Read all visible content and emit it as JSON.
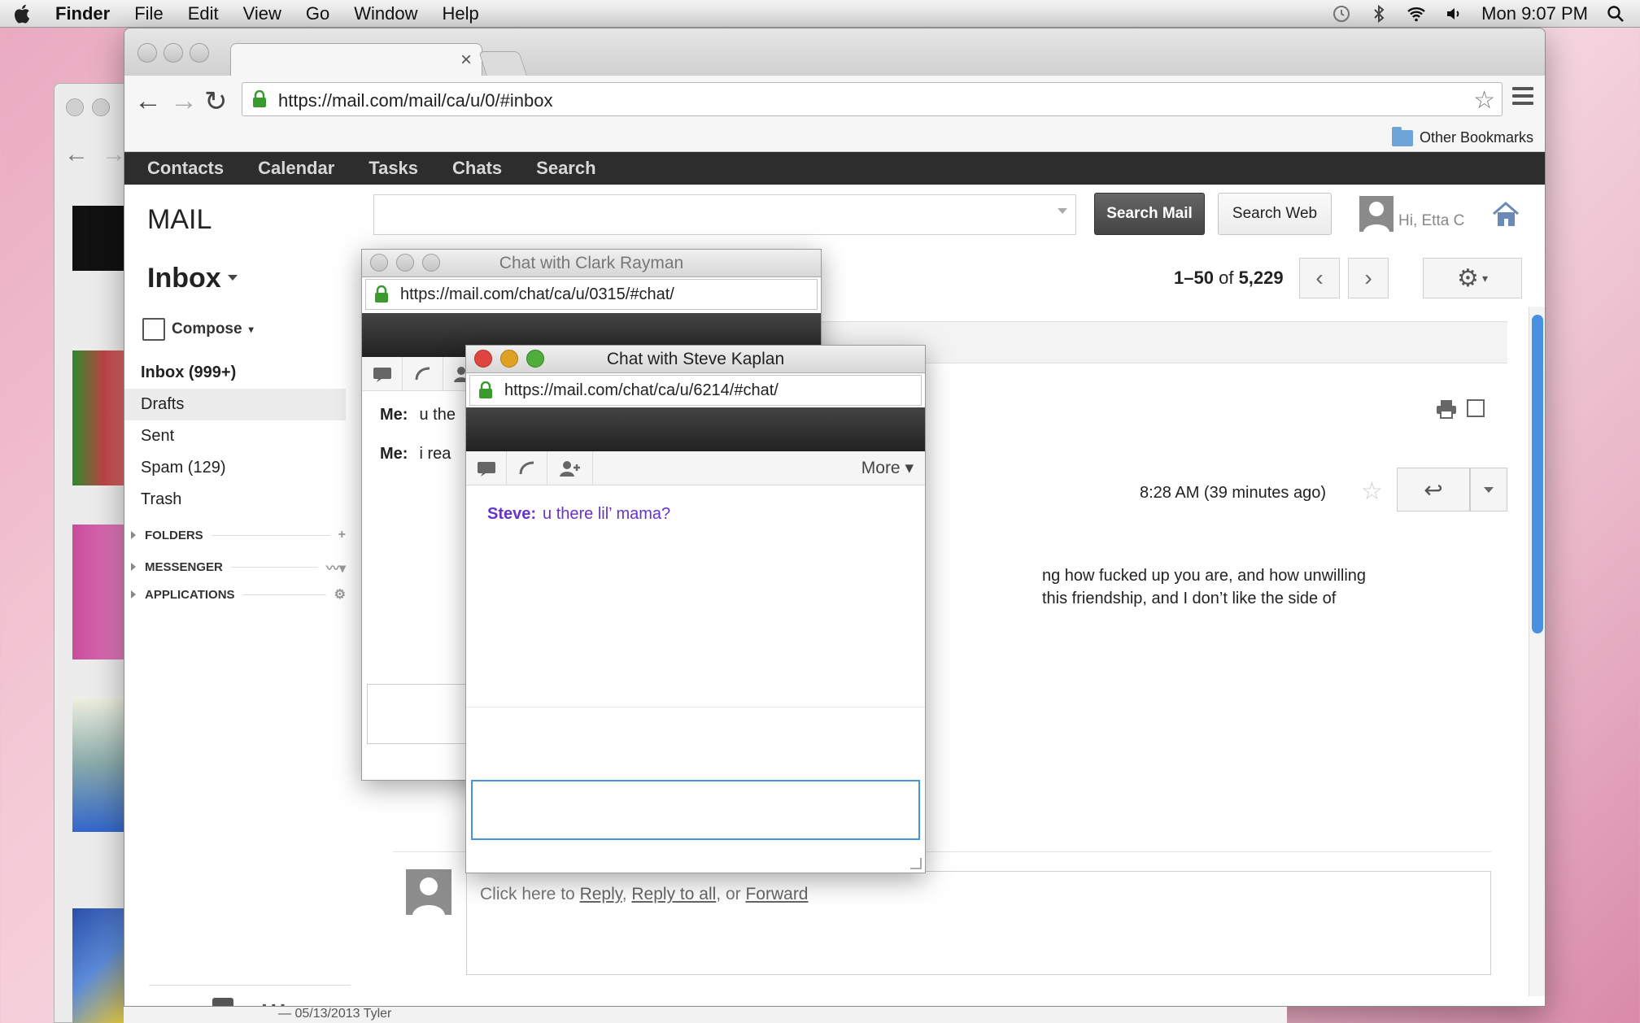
{
  "menubar": {
    "app_name": "Finder",
    "items": [
      "File",
      "Edit",
      "View",
      "Go",
      "Window",
      "Help"
    ],
    "clock": "Mon 9:07 PM"
  },
  "browser": {
    "url": "https://mail.com/mail/ca/u/0/#inbox",
    "bookmark_folder": "Other Bookmarks",
    "tab_close": "×"
  },
  "appnav": [
    "Contacts",
    "Calendar",
    "Tasks",
    "Chats",
    "Search"
  ],
  "mail": {
    "logo": "MAIL",
    "search_placeholder": "",
    "search_mail_label": "Search Mail",
    "search_web_label": "Search Web",
    "greeting": "Hi, Etta C",
    "inbox_title": "Inbox",
    "pager_range": "1–50",
    "pager_of": "of",
    "pager_total": "5,229",
    "compose_label": "Compose",
    "folders": [
      "Inbox (999+)",
      "Drafts",
      "Sent",
      "Spam (129)",
      "Trash"
    ],
    "sections": [
      "FOLDERS",
      "MESSENGER",
      "APPLICATIONS"
    ],
    "timestamp": "8:28 AM (39 minutes ago)",
    "body_lines": [
      "ng how fucked up you are, and how unwilling",
      "this friendship, and I don’t like the side of"
    ],
    "reply_prompt": {
      "prefix": "Click here to",
      "reply": "Reply",
      "sep1": ",",
      "reply_all": "Reply to all",
      "sep2": ", or",
      "forward": "Forward"
    }
  },
  "chat_back": {
    "title": "Chat with Clark Rayman",
    "url": "https://mail.com/chat/ca/u/0315/#chat/",
    "lines": [
      {
        "speaker": "Me:",
        "text": "u the"
      },
      {
        "speaker": "Me:",
        "text": "i rea"
      }
    ]
  },
  "chat_front": {
    "title": "Chat with Steve Kaplan",
    "url": "https://mail.com/chat/ca/u/6214/#chat/",
    "more_label": "More ▾",
    "message": {
      "speaker": "Steve:",
      "text": "u there lil’ mama?"
    }
  },
  "bottom_strip": "— 05/13/2013 Tyler",
  "colors": {
    "scroll_accent": "#4a90e2",
    "chat_message": "#6633cc",
    "close_red": "#e0443e",
    "min_yellow": "#dea123",
    "max_green": "#4fae3b"
  }
}
